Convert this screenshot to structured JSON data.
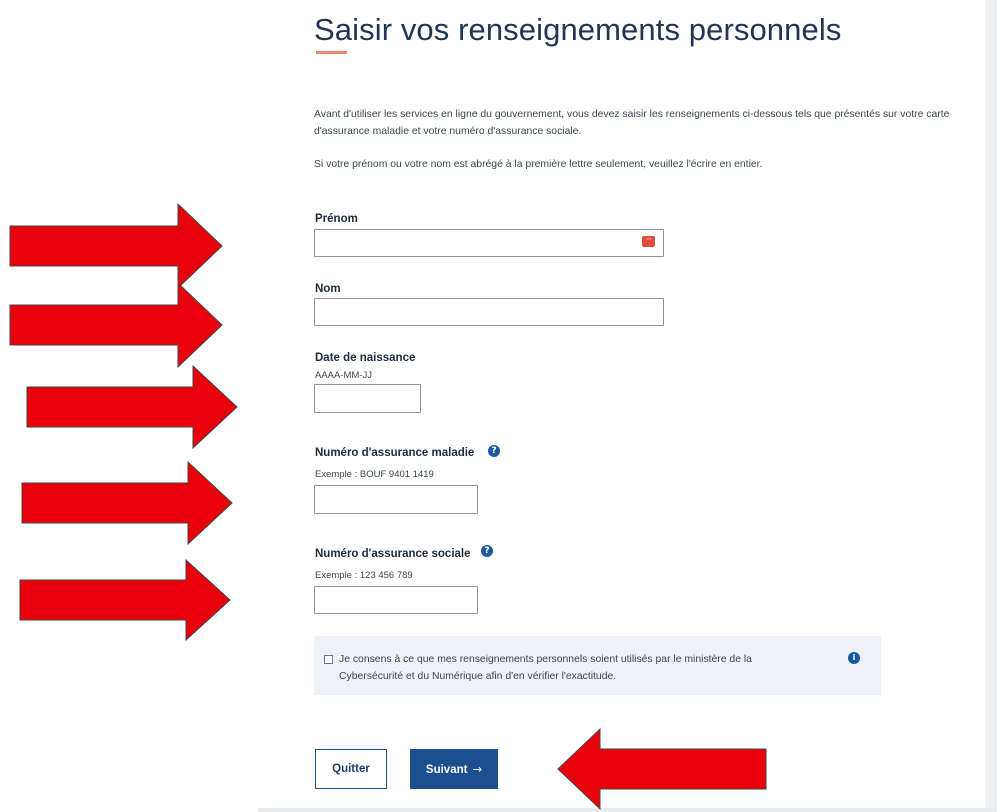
{
  "page": {
    "title": "Saisir vos renseignements personnels",
    "intro": "Avant d'utiliser les services en ligne du gouvernement, vous devez saisir les renseignements ci-dessous tels que présentés sur votre carte d'assurance maladie et votre numéro d'assurance sociale.",
    "note": "Si votre prénom ou votre nom est abrégé à la première lettre seulement, veuillez l'écrire en entier.",
    "accent_color": "#1c4f8e",
    "title_color": "#223654",
    "underline_color": "#e58a6a"
  },
  "form": {
    "first_name": {
      "label": "Prénom",
      "value": "",
      "autofill_icon": "password-manager-icon"
    },
    "last_name": {
      "label": "Nom",
      "value": ""
    },
    "birth_date": {
      "label": "Date de naissance",
      "hint": "AAAA-MM-JJ",
      "value": ""
    },
    "health_insurance": {
      "label": "Numéro d'assurance maladie",
      "hint": "Exemple : BOUF 9401 1419",
      "value": "",
      "help_icon": "question-circle-icon"
    },
    "social_insurance": {
      "label": "Numéro d'assurance sociale",
      "hint": "Exemple : 123 456 789",
      "value": "",
      "help_icon": "question-circle-icon"
    }
  },
  "consent": {
    "checked": false,
    "text": "Je consens à ce que mes renseignements personnels soient utilisés par le ministère de la Cybersécurité et du Numérique afin d'en vérifier l'exactitude.",
    "info_icon": "info-circle-icon"
  },
  "buttons": {
    "quit_label": "Quitter",
    "next_label": "Suivant",
    "next_icon": "arrow-right-icon"
  },
  "annotations": {
    "arrow_color": "#e8000b",
    "arrow_count": 6
  }
}
